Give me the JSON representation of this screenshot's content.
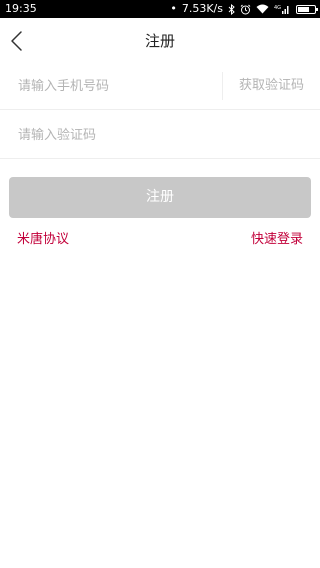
{
  "status_bar": {
    "time": "19:35",
    "network_speed": "7.53K/s",
    "dots": "•",
    "network_type": "4G",
    "battery_level": 0.7,
    "icons": [
      "dots-icon",
      "bluetooth-icon",
      "alarm-icon",
      "wifi-icon",
      "signal-icon",
      "battery-icon"
    ]
  },
  "header": {
    "title": "注册",
    "back_icon": "chevron-left-icon"
  },
  "form": {
    "phone_placeholder": "请输入手机号码",
    "phone_value": "",
    "get_code_label": "获取验证码",
    "code_placeholder": "请输入验证码",
    "code_value": ""
  },
  "register_button_label": "注册",
  "links": {
    "agreement": "米唐协议",
    "quick_login": "快速登录"
  },
  "colors": {
    "accent": "#c2003a",
    "button_disabled": "#c8c8c8",
    "placeholder": "#b4b4b4",
    "divider": "#eeeeee"
  }
}
